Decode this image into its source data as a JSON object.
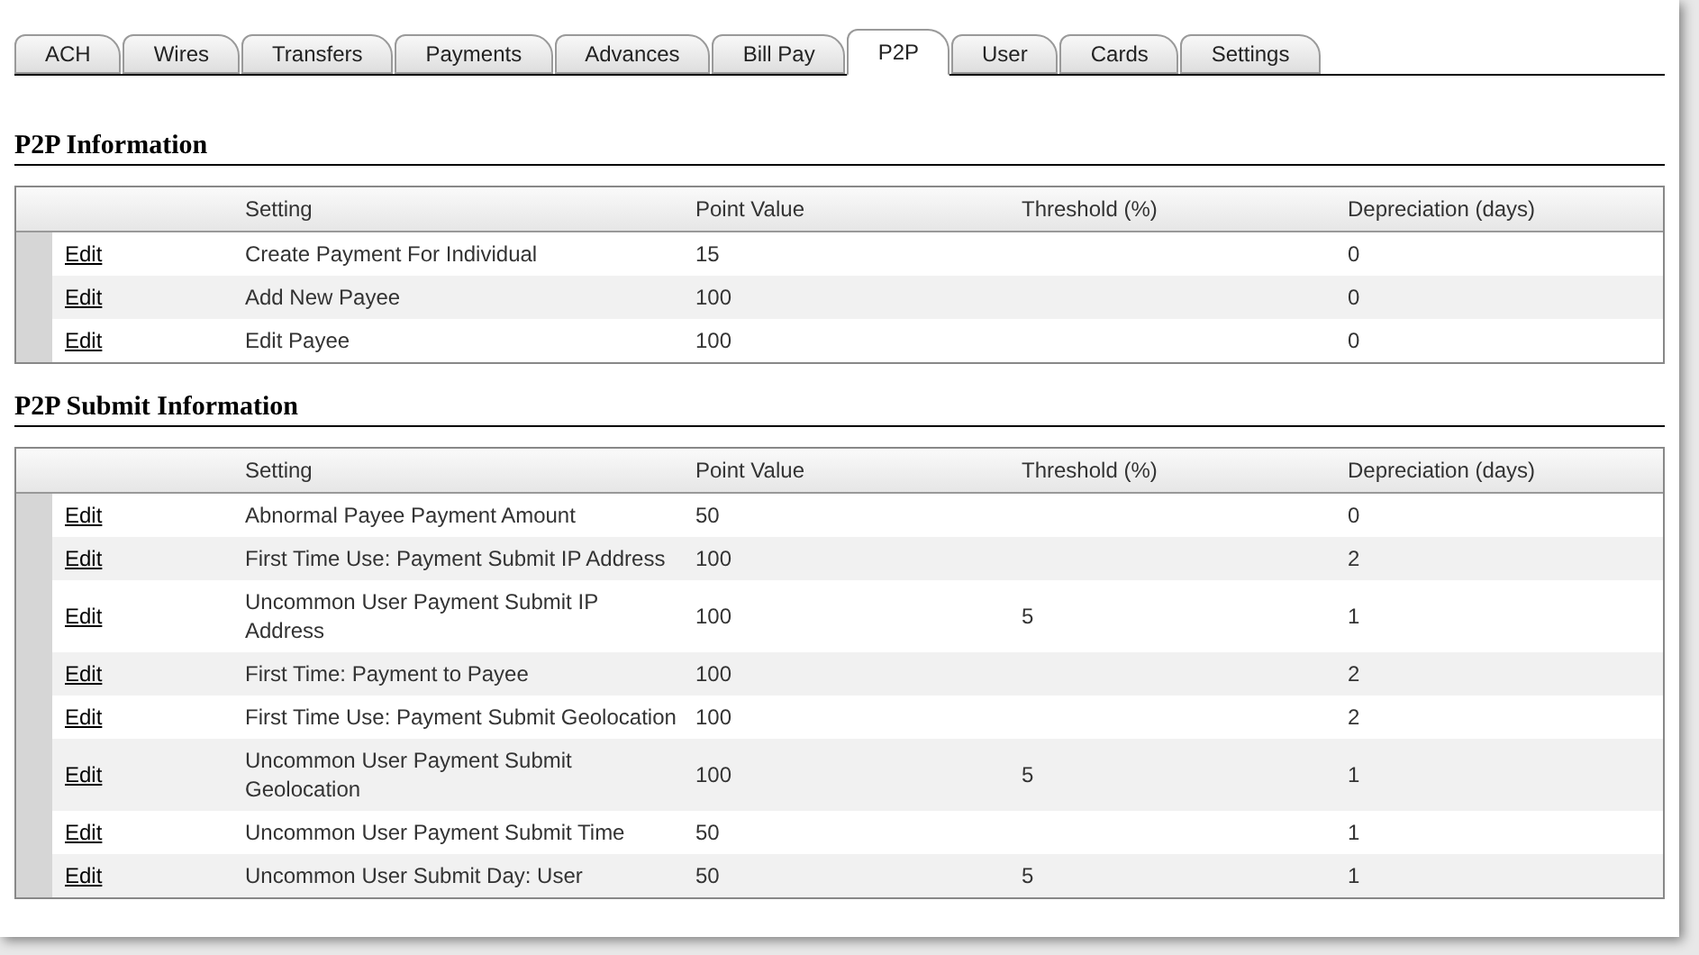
{
  "tabs": [
    {
      "label": "ACH",
      "selected": false
    },
    {
      "label": "Wires",
      "selected": false
    },
    {
      "label": "Transfers",
      "selected": false
    },
    {
      "label": "Payments",
      "selected": false
    },
    {
      "label": "Advances",
      "selected": false
    },
    {
      "label": "Bill Pay",
      "selected": false
    },
    {
      "label": "P2P",
      "selected": true
    },
    {
      "label": "User",
      "selected": false
    },
    {
      "label": "Cards",
      "selected": false
    },
    {
      "label": "Settings",
      "selected": false
    }
  ],
  "sections": [
    {
      "title": "P2P Information",
      "columns": [
        "Setting",
        "Point Value",
        "Threshold (%)",
        "Depreciation (days)"
      ],
      "rows": [
        {
          "action": "Edit",
          "setting": "Create Payment For Individual",
          "point_value": "15",
          "depreciation": "0"
        },
        {
          "action": "Edit",
          "setting": "Add New Payee",
          "point_value": "100",
          "depreciation": "0"
        },
        {
          "action": "Edit",
          "setting": "Edit Payee",
          "point_value": "100",
          "depreciation": "0"
        }
      ]
    },
    {
      "title": "P2P Submit Information",
      "columns": [
        "Setting",
        "Point Value",
        "Threshold (%)",
        "Depreciation (days)"
      ],
      "rows": [
        {
          "action": "Edit",
          "setting": "Abnormal Payee Payment Amount",
          "point_value": "50",
          "depreciation": "0"
        },
        {
          "action": "Edit",
          "setting": "First Time Use: Payment Submit IP Address",
          "point_value": "100",
          "depreciation": "2"
        },
        {
          "action": "Edit",
          "setting": "Uncommon User Payment Submit IP Address",
          "point_value": "100",
          "threshold": "5",
          "depreciation": "1"
        },
        {
          "action": "Edit",
          "setting": "First Time: Payment to Payee",
          "point_value": "100",
          "depreciation": "2"
        },
        {
          "action": "Edit",
          "setting": "First Time Use: Payment Submit Geolocation",
          "point_value": "100",
          "depreciation": "2"
        },
        {
          "action": "Edit",
          "setting": "Uncommon User Payment Submit Geolocation",
          "point_value": "100",
          "threshold": "5",
          "depreciation": "1"
        },
        {
          "action": "Edit",
          "setting": "Uncommon User Payment Submit Time",
          "point_value": "50",
          "depreciation": "1"
        },
        {
          "action": "Edit",
          "setting": "Uncommon User Submit Day: User",
          "point_value": "50",
          "threshold": "5",
          "depreciation": "1"
        }
      ]
    }
  ]
}
